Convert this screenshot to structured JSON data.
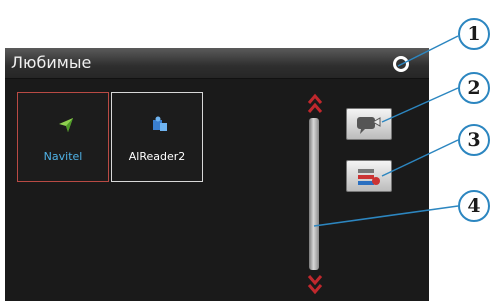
{
  "header": {
    "title": "Любимые"
  },
  "favorites": [
    {
      "label": "Navitel",
      "icon": "navitel-arrow-icon",
      "selected": true
    },
    {
      "label": "AlReader2",
      "icon": "book-puzzle-icon",
      "selected": false
    }
  ],
  "actions": [
    {
      "icon": "message-arrow-icon"
    },
    {
      "icon": "list-settings-icon"
    }
  ],
  "callouts": [
    "1",
    "2",
    "3",
    "4"
  ],
  "colors": {
    "callout_border": "#2c86c0",
    "selected_border": "#b94a44",
    "selected_label": "#4fb2e6",
    "scroll_arrow": "#c0282d"
  }
}
